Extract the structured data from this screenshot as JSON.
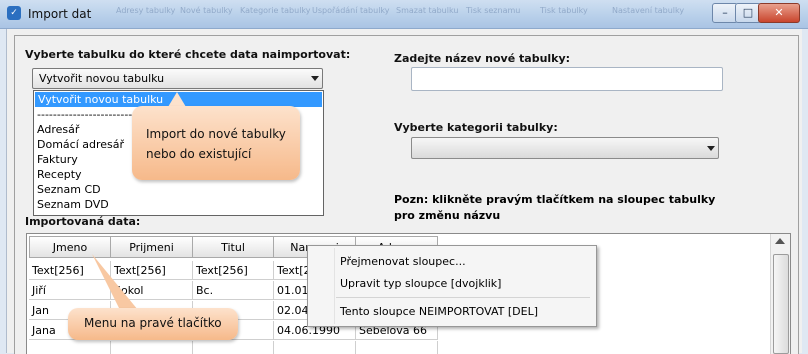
{
  "window": {
    "title": "Import dat",
    "background_titles": [
      "Adresy tabulky",
      "Nové tabulky",
      "Kategorie tabulky",
      "Uspořádání tabulky",
      "Smazat tabulku",
      "Tisk seznamu",
      "Tisk tabulky",
      "Nastavení tabulky"
    ],
    "minimize": "–",
    "maximize": "□",
    "close": "✕"
  },
  "left": {
    "label": "Vyberte tabulku do které chcete data naimportovat:",
    "selected": "Vytvořit novou tabulku",
    "options": [
      "Vytvořit novou tabulku",
      "-------------------------",
      "Adresář",
      "Domácí adresář",
      "Faktury",
      "Recepty",
      "Seznam CD",
      "Seznam DVD"
    ],
    "callout": "Import do nové tabulky nebo do existující"
  },
  "right": {
    "new_name_label": "Zadejte název nové tabulky:",
    "new_name_value": "",
    "category_label": "Vyberte kategorii tabulky:",
    "category_value": "",
    "note": "Pozn: klikněte pravým tlačítkem na sloupec tabulky pro změnu názvu"
  },
  "grid": {
    "label": "Importovaná data:",
    "columns": [
      "Jmeno",
      "Prijmeni",
      "Titul",
      "Narozeni",
      "Adresa"
    ],
    "types": [
      "Text[256]",
      "Text[256]",
      "Text[256]",
      "Text[256]",
      ""
    ],
    "rows": [
      [
        "Jiří",
        "Sokol",
        "Bc.",
        "01.01",
        ""
      ],
      [
        "Jan",
        "",
        "",
        "02.04",
        ""
      ],
      [
        "Jana",
        "",
        "",
        "04.06.1990",
        "Sebelova 66"
      ]
    ]
  },
  "context_menu": {
    "rename": "Přejmenovat sloupec...",
    "change_type": "Upravit typ sloupce [dvojklik]",
    "skip": "Tento sloupce NEIMPORTOVAT [DEL]"
  },
  "callout_menu": "Menu na pravé tlačítko",
  "colors": {
    "selection": "#3399ff",
    "callout": "#f6b98a",
    "close_button": "#c9452d"
  }
}
